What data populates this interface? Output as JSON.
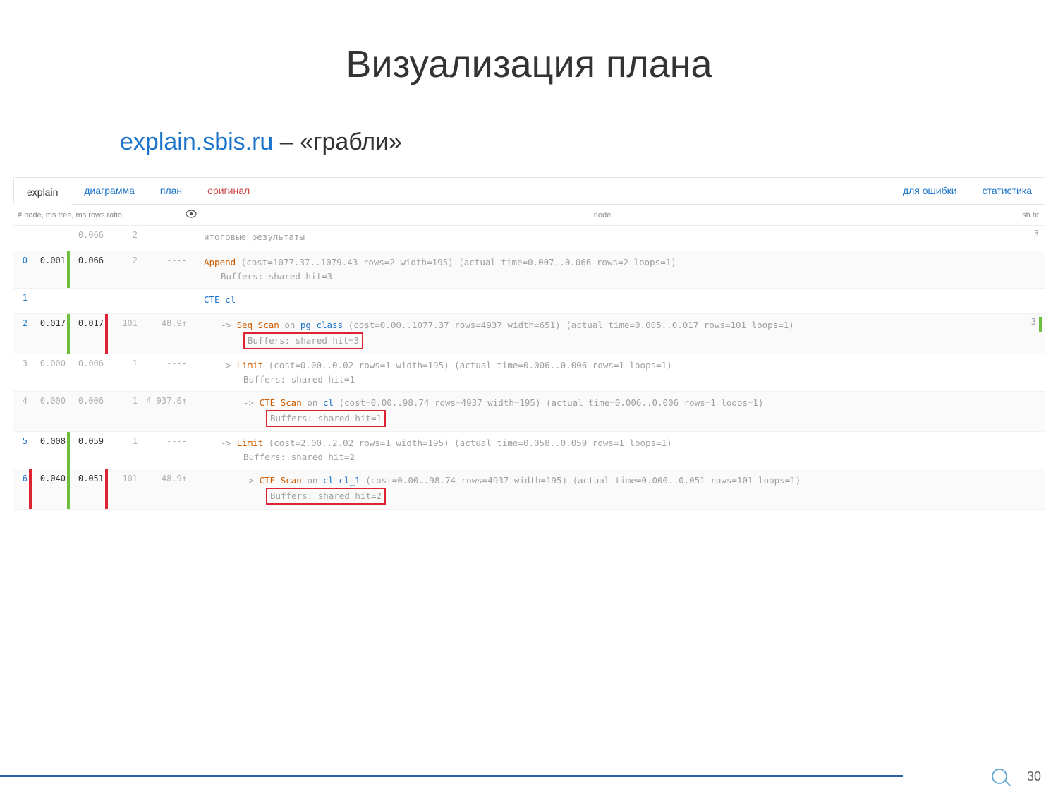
{
  "title": "Визуализация плана",
  "sub_link": "explain.sbis.ru",
  "sub_tail": " – «грабли»",
  "tabs": {
    "explain": "explain",
    "diagram": "диаграмма",
    "plan": "план",
    "original": "оригинал",
    "error": "для ошибки",
    "stats": "статистика"
  },
  "hdr": {
    "left": "#  node, ms  tree, ms  rows      ratio",
    "node": "node",
    "shht": "sh.ht"
  },
  "r_top": {
    "tree": "0.066",
    "rows": "2",
    "node": "итоговые результаты",
    "sh": "3"
  },
  "r0": {
    "idx": "0",
    "node_ms": "0.001",
    "tree": "0.066",
    "rows": "2",
    "ratio": "----",
    "l1a": "Append",
    "l1b": "  (cost=1077.37..1079.43 rows=2 width=195) (actual time=0.007..0.066 rows=2 loops=1)",
    "l2": "Buffers: shared hit=3"
  },
  "r1": {
    "idx": "1",
    "l1a": "CTE ",
    "l1b": "cl"
  },
  "r2": {
    "idx": "2",
    "node_ms": "0.017",
    "tree": "0.017",
    "rows": "101",
    "ratio": "48.9↑",
    "arrow": "->  ",
    "kw": "Seq Scan",
    "mid": " on ",
    "tbl": "pg_class",
    "rest": "  (cost=0.00..1077.37 rows=4937 width=651) (actual time=0.005..0.017 rows=101 loops=1)",
    "buf": "Buffers: shared hit=3",
    "sh": "3"
  },
  "r3": {
    "idx": "3",
    "node_ms": "0.000",
    "tree": "0.006",
    "rows": "1",
    "ratio": "----",
    "arrow": "->  ",
    "kw": "Limit",
    "rest": "  (cost=0.00..0.02 rows=1 width=195) (actual time=0.006..0.006 rows=1 loops=1)",
    "buf": "Buffers: shared hit=1"
  },
  "r4": {
    "idx": "4",
    "node_ms": "0.000",
    "tree": "0.006",
    "rows": "1",
    "ratio": "4 937.0↑",
    "arrow": "->  ",
    "kw": "CTE Scan",
    "mid": " on ",
    "tbl": "cl",
    "rest": "  (cost=0.00..98.74 rows=4937 width=195) (actual time=0.006..0.006 rows=1 loops=1)",
    "buf": "Buffers: shared hit=1"
  },
  "r5": {
    "idx": "5",
    "node_ms": "0.008",
    "tree": "0.059",
    "rows": "1",
    "ratio": "----",
    "arrow": "->  ",
    "kw": "Limit",
    "rest": "  (cost=2.00..2.02 rows=1 width=195) (actual time=0.058..0.059 rows=1 loops=1)",
    "buf": "Buffers: shared hit=2"
  },
  "r6": {
    "idx": "6",
    "node_ms": "0.040",
    "tree": "0.051",
    "rows": "101",
    "ratio": "48.9↑",
    "arrow": "->  ",
    "kw": "CTE Scan",
    "mid": " on ",
    "tbl": "cl cl_1",
    "rest": "  (cost=0.00..98.74 rows=4937 width=195) (actual time=0.000..0.051 rows=101 loops=1)",
    "buf": "Buffers: shared hit=2"
  },
  "page": "30"
}
